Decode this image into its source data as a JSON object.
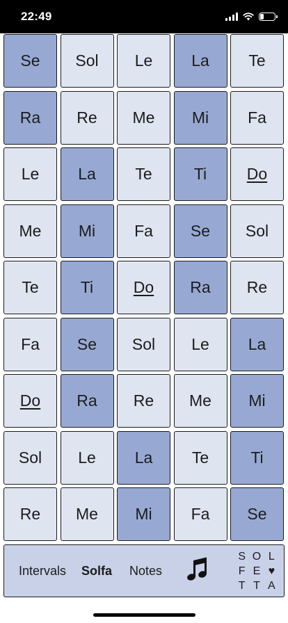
{
  "status_bar": {
    "time": "22:49",
    "battery_level": 0.25
  },
  "grid": {
    "rows": [
      [
        {
          "label": "Se",
          "shade": "dark"
        },
        {
          "label": "Sol",
          "shade": "light"
        },
        {
          "label": "Le",
          "shade": "light"
        },
        {
          "label": "La",
          "shade": "dark"
        },
        {
          "label": "Te",
          "shade": "light"
        }
      ],
      [
        {
          "label": "Ra",
          "shade": "dark"
        },
        {
          "label": "Re",
          "shade": "light"
        },
        {
          "label": "Me",
          "shade": "light"
        },
        {
          "label": "Mi",
          "shade": "dark"
        },
        {
          "label": "Fa",
          "shade": "light"
        }
      ],
      [
        {
          "label": "Le",
          "shade": "light"
        },
        {
          "label": "La",
          "shade": "dark"
        },
        {
          "label": "Te",
          "shade": "light"
        },
        {
          "label": "Ti",
          "shade": "dark"
        },
        {
          "label": "Do",
          "shade": "light",
          "underlined": true
        }
      ],
      [
        {
          "label": "Me",
          "shade": "light"
        },
        {
          "label": "Mi",
          "shade": "dark"
        },
        {
          "label": "Fa",
          "shade": "light"
        },
        {
          "label": "Se",
          "shade": "dark"
        },
        {
          "label": "Sol",
          "shade": "light"
        }
      ],
      [
        {
          "label": "Te",
          "shade": "light"
        },
        {
          "label": "Ti",
          "shade": "dark"
        },
        {
          "label": "Do",
          "shade": "light",
          "underlined": true
        },
        {
          "label": "Ra",
          "shade": "dark"
        },
        {
          "label": "Re",
          "shade": "light"
        }
      ],
      [
        {
          "label": "Fa",
          "shade": "light"
        },
        {
          "label": "Se",
          "shade": "dark"
        },
        {
          "label": "Sol",
          "shade": "light"
        },
        {
          "label": "Le",
          "shade": "light"
        },
        {
          "label": "La",
          "shade": "dark"
        }
      ],
      [
        {
          "label": "Do",
          "shade": "light",
          "underlined": true
        },
        {
          "label": "Ra",
          "shade": "dark"
        },
        {
          "label": "Re",
          "shade": "light"
        },
        {
          "label": "Me",
          "shade": "light"
        },
        {
          "label": "Mi",
          "shade": "dark"
        }
      ],
      [
        {
          "label": "Sol",
          "shade": "light"
        },
        {
          "label": "Le",
          "shade": "light"
        },
        {
          "label": "La",
          "shade": "dark"
        },
        {
          "label": "Te",
          "shade": "light"
        },
        {
          "label": "Ti",
          "shade": "dark"
        }
      ],
      [
        {
          "label": "Re",
          "shade": "light"
        },
        {
          "label": "Me",
          "shade": "light"
        },
        {
          "label": "Mi",
          "shade": "dark"
        },
        {
          "label": "Fa",
          "shade": "light"
        },
        {
          "label": "Se",
          "shade": "dark"
        }
      ]
    ]
  },
  "tab_bar": {
    "tabs": [
      {
        "label": "Intervals",
        "active": false
      },
      {
        "label": "Solfa",
        "active": true
      },
      {
        "label": "Notes",
        "active": false
      }
    ],
    "music_icon": "music-note-icon",
    "logo": [
      "S",
      "O",
      "L",
      "F",
      "E",
      "♥",
      "T",
      "T",
      "A"
    ]
  },
  "colors": {
    "cell_light": "#dfe4f1",
    "cell_dark": "#97a9d3",
    "tab_bar": "#c8d1e8",
    "text": "#1c1c1c"
  }
}
